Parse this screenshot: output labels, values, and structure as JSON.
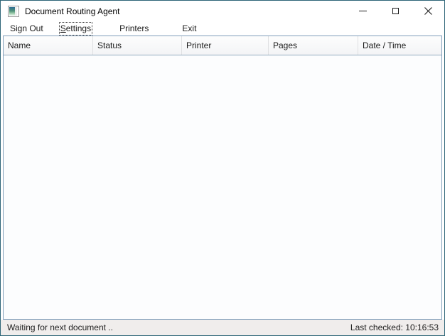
{
  "window": {
    "title": "Document Routing Agent"
  },
  "menu_bar": {
    "items": [
      {
        "label": "Sign Out",
        "focused": false
      },
      {
        "label": "Settings",
        "focused": true
      },
      {
        "label": "Printers",
        "focused": false
      },
      {
        "label": "Exit",
        "focused": false
      }
    ]
  },
  "table": {
    "columns": [
      {
        "label": "Name"
      },
      {
        "label": "Status"
      },
      {
        "label": "Printer"
      },
      {
        "label": "Pages"
      },
      {
        "label": "Date / Time"
      }
    ],
    "rows": []
  },
  "status_bar": {
    "left": "Waiting for next document ..",
    "right": "Last checked: 10:16:53"
  },
  "colors": {
    "window_border": "#2d6577",
    "list_border": "#7f9db9",
    "header_bottom_border": "#93adc0",
    "header_separator": "#dfe0e2",
    "status_bar_bg": "#f0edec",
    "body_bg": "#fcfdfe",
    "icon_gradient_top": "#2f6e95",
    "icon_gradient_mid": "#4f9277"
  }
}
